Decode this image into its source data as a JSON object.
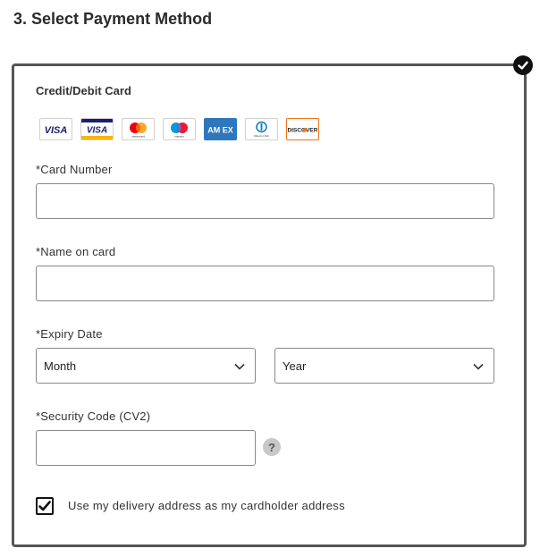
{
  "section": {
    "title": "3. Select Payment Method"
  },
  "payment_method": {
    "title": "Credit/Debit Card",
    "selected": true,
    "card_logos": [
      {
        "name": "visa",
        "text": "VISA"
      },
      {
        "name": "visa-electron",
        "text": "VISA"
      },
      {
        "name": "mastercard",
        "text": "mastercard"
      },
      {
        "name": "maestro",
        "text": "maestro"
      },
      {
        "name": "amex",
        "text": "AM EX"
      },
      {
        "name": "diners-club",
        "text": "Diners Club"
      },
      {
        "name": "discover",
        "text": "DISCOVER"
      }
    ]
  },
  "fields": {
    "card_number_label": "*Card Number",
    "card_number_value": "",
    "name_label": "*Name on card",
    "name_value": "",
    "expiry_label": "*Expiry Date",
    "month_value": "Month",
    "year_value": "Year",
    "security_label": "*Security Code (CV2)",
    "security_value": "",
    "help_glyph": "?"
  },
  "delivery_checkbox": {
    "label": "Use my delivery address as my cardholder address",
    "checked": true
  },
  "colors": {
    "border": "#555555",
    "input_border": "#888888",
    "check": "#111111"
  },
  "icons": [
    "checkmark-badge-icon",
    "chevron-down-icon",
    "question-icon",
    "checkbox-check-icon"
  ]
}
